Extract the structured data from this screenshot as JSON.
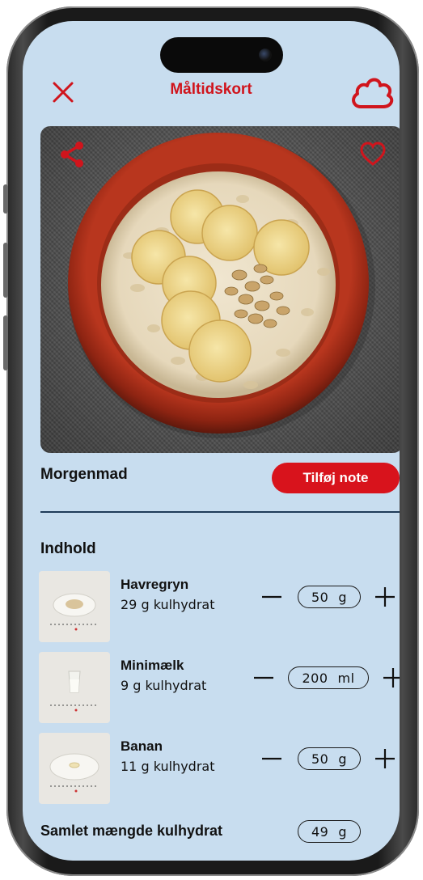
{
  "header": {
    "title": "Måltidskort",
    "close_icon": "close-icon",
    "logo_icon": "cloud-logo-icon"
  },
  "hero": {
    "share_icon": "share-icon",
    "favorite_icon": "heart-icon"
  },
  "meal": {
    "name": "Morgenmad",
    "note_button": "Tilføj note"
  },
  "contents": {
    "title": "Indhold",
    "items": [
      {
        "name": "Havregryn",
        "carbs": "29 g kulhydrat",
        "amount": "50",
        "unit": "g"
      },
      {
        "name": "Minimælk",
        "carbs": "9 g kulhydrat",
        "amount": "200",
        "unit": "ml"
      },
      {
        "name": "Banan",
        "carbs": "11 g kulhydrat",
        "amount": "50",
        "unit": "g"
      }
    ]
  },
  "total": {
    "label": "Samlet mængde kulhydrat",
    "amount": "49",
    "unit": "g"
  },
  "colors": {
    "accent": "#d8131c",
    "background": "#c8ddef",
    "divider": "#1f3b58"
  }
}
